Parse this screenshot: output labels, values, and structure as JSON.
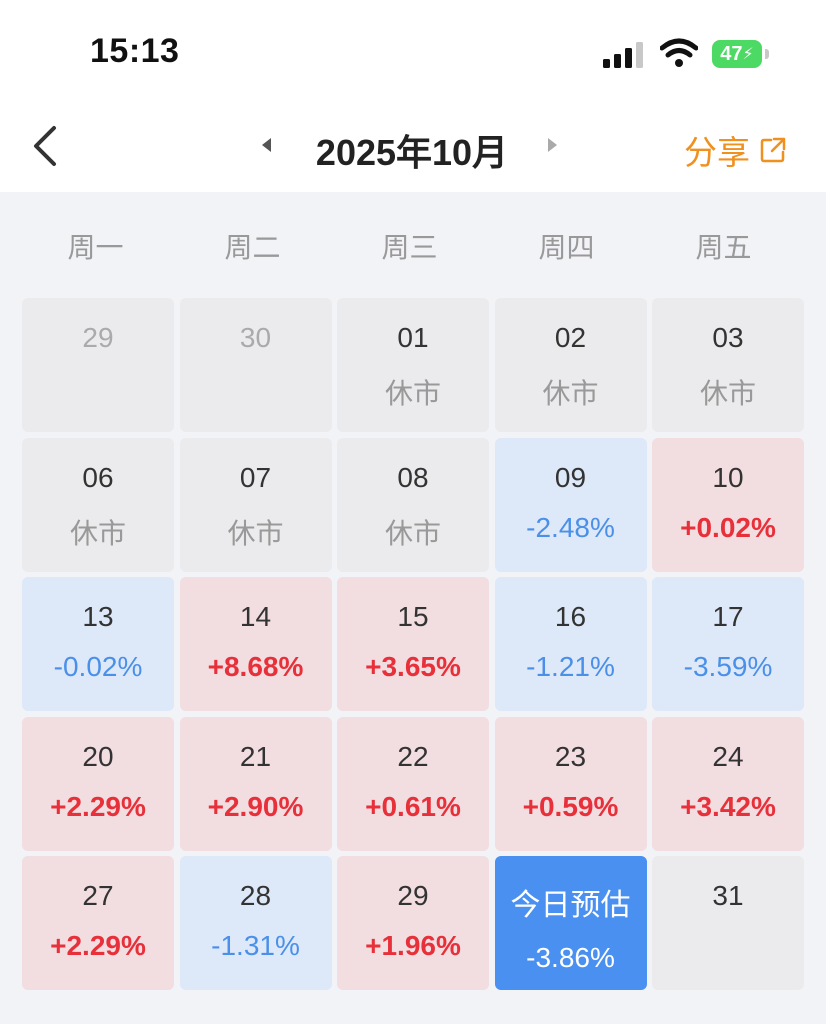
{
  "status_bar": {
    "time": "15:13",
    "battery": "47",
    "icons": [
      "signal-icon",
      "wifi-icon",
      "battery-charging-icon"
    ]
  },
  "nav": {
    "title": "2025年10月",
    "share_label": "分享",
    "icons": [
      "back-chevron-icon",
      "prev-month-icon",
      "next-month-icon",
      "share-external-icon"
    ],
    "accent_color": "#f0901e"
  },
  "weekdays": [
    "周一",
    "周二",
    "周三",
    "周四",
    "周五"
  ],
  "colors": {
    "up": "#e8303a",
    "down": "#4a90e8",
    "today": "#4a90f0",
    "up_bg": "#f2dde0",
    "down_bg": "#dde8f8",
    "closed_bg": "#ebebed"
  },
  "days": [
    {
      "day": "29",
      "sub": "",
      "type": "faded"
    },
    {
      "day": "30",
      "sub": "",
      "type": "faded"
    },
    {
      "day": "01",
      "sub": "休市",
      "type": "closed"
    },
    {
      "day": "02",
      "sub": "休市",
      "type": "closed"
    },
    {
      "day": "03",
      "sub": "休市",
      "type": "closed"
    },
    {
      "day": "06",
      "sub": "休市",
      "type": "closed"
    },
    {
      "day": "07",
      "sub": "休市",
      "type": "closed"
    },
    {
      "day": "08",
      "sub": "休市",
      "type": "closed"
    },
    {
      "day": "09",
      "sub": "-2.48%",
      "type": "down"
    },
    {
      "day": "10",
      "sub": "+0.02%",
      "type": "up"
    },
    {
      "day": "13",
      "sub": "-0.02%",
      "type": "down"
    },
    {
      "day": "14",
      "sub": "+8.68%",
      "type": "up"
    },
    {
      "day": "15",
      "sub": "+3.65%",
      "type": "up"
    },
    {
      "day": "16",
      "sub": "-1.21%",
      "type": "down"
    },
    {
      "day": "17",
      "sub": "-3.59%",
      "type": "down"
    },
    {
      "day": "20",
      "sub": "+2.29%",
      "type": "up"
    },
    {
      "day": "21",
      "sub": "+2.90%",
      "type": "up"
    },
    {
      "day": "22",
      "sub": "+0.61%",
      "type": "up"
    },
    {
      "day": "23",
      "sub": "+0.59%",
      "type": "up"
    },
    {
      "day": "24",
      "sub": "+3.42%",
      "type": "up"
    },
    {
      "day": "27",
      "sub": "+2.29%",
      "type": "up"
    },
    {
      "day": "28",
      "sub": "-1.31%",
      "type": "down"
    },
    {
      "day": "29",
      "sub": "+1.96%",
      "type": "up"
    },
    {
      "day": "今日预估",
      "sub": "-3.86%",
      "type": "today"
    },
    {
      "day": "31",
      "sub": "",
      "type": "empty"
    }
  ]
}
